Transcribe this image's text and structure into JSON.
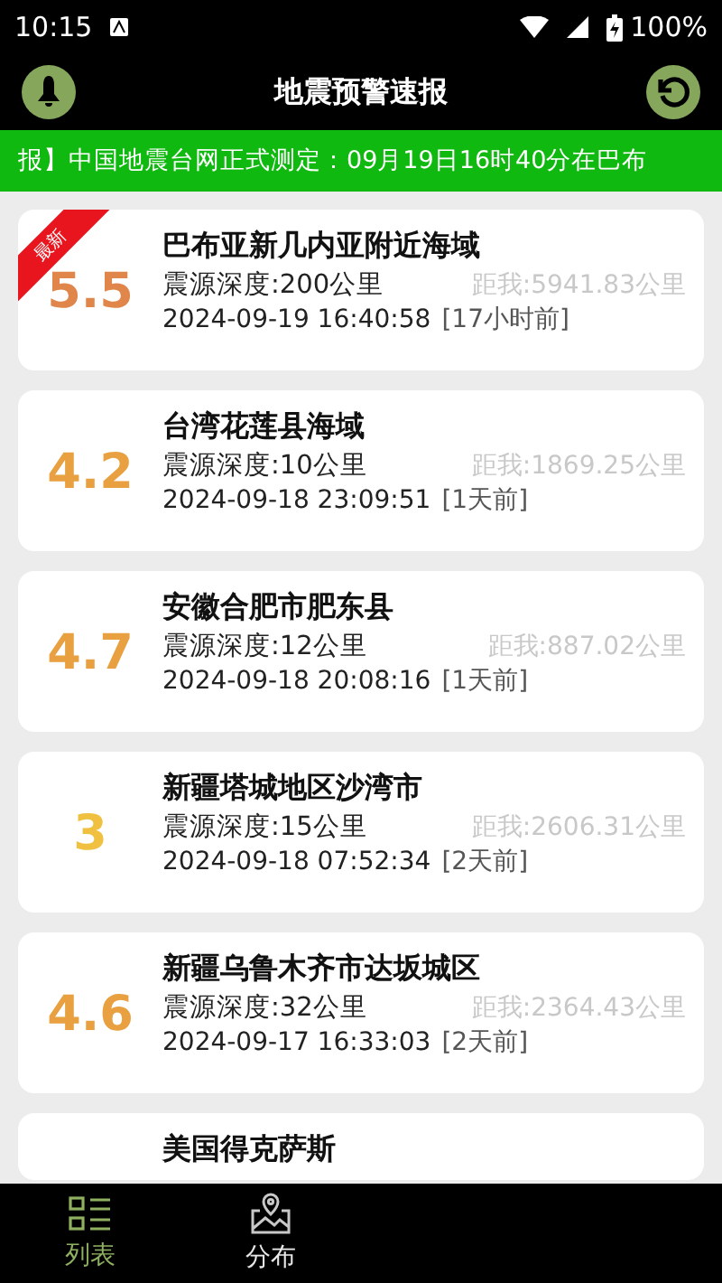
{
  "status_bar": {
    "time": "10:15",
    "battery": "100%"
  },
  "header": {
    "title": "地震预警速报"
  },
  "ticker": {
    "text": "报】中国地震台网正式测定：09月19日16时40分在巴布"
  },
  "quakes": [
    {
      "magnitude": "5.5",
      "color": "#e0864a",
      "latest": true,
      "badge": "最新",
      "place": "巴布亚新几内亚附近海域",
      "depth": "震源深度:200公里",
      "distance": "距我:5941.83公里",
      "time": "2024-09-19 16:40:58",
      "ago": "[17小时前]"
    },
    {
      "magnitude": "4.2",
      "color": "#e8a040",
      "latest": false,
      "place": "台湾花莲县海域",
      "depth": "震源深度:10公里",
      "distance": "距我:1869.25公里",
      "time": "2024-09-18 23:09:51",
      "ago": "[1天前]"
    },
    {
      "magnitude": "4.7",
      "color": "#e8a040",
      "latest": false,
      "place": "安徽合肥市肥东县",
      "depth": "震源深度:12公里",
      "distance": "距我:887.02公里",
      "time": "2024-09-18 20:08:16",
      "ago": "[1天前]"
    },
    {
      "magnitude": "3",
      "color": "#f0c040",
      "latest": false,
      "place": "新疆塔城地区沙湾市",
      "depth": "震源深度:15公里",
      "distance": "距我:2606.31公里",
      "time": "2024-09-18 07:52:34",
      "ago": "[2天前]"
    },
    {
      "magnitude": "4.6",
      "color": "#e8a040",
      "latest": false,
      "place": "新疆乌鲁木齐市达坂城区",
      "depth": "震源深度:32公里",
      "distance": "距我:2364.43公里",
      "time": "2024-09-17 16:33:03",
      "ago": "[2天前]"
    },
    {
      "latest": false,
      "place": "美国得克萨斯"
    }
  ],
  "nav": [
    {
      "kind": "list",
      "label": "列表",
      "selected": true
    },
    {
      "kind": "map",
      "label": "分布",
      "selected": false
    }
  ]
}
